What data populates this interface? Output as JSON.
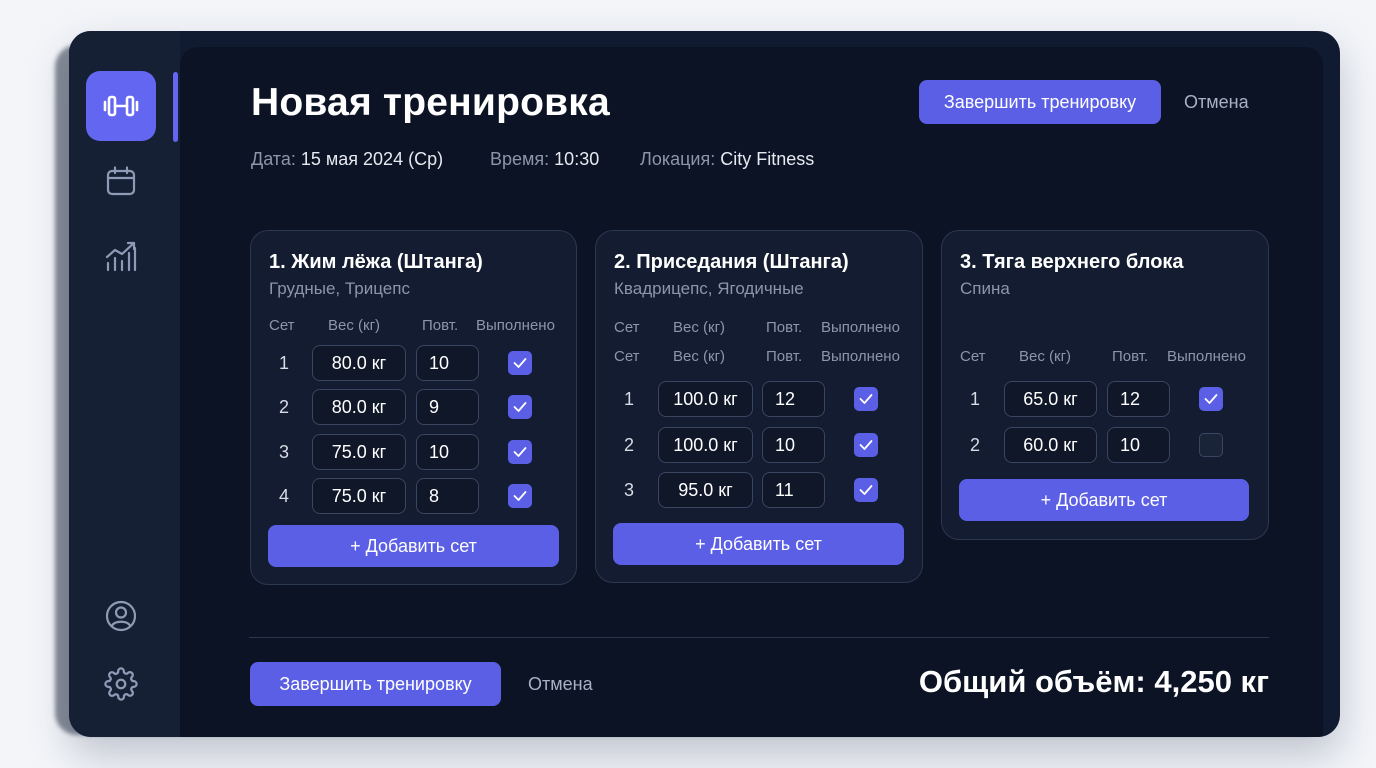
{
  "sidebar": {
    "items": [
      {
        "icon": "dumbbell-icon",
        "active": true
      },
      {
        "icon": "calendar-icon",
        "active": false
      },
      {
        "icon": "chart-icon",
        "active": false
      },
      {
        "icon": "user-icon",
        "active": false
      },
      {
        "icon": "gear-icon",
        "active": false
      }
    ]
  },
  "header": {
    "title": "Новая тренировка",
    "finish_label": "Завершить тренировку",
    "cancel_label": "Отмена"
  },
  "meta": {
    "date_label": "Дата:",
    "date_value": "15 мая 2024 (Ср)",
    "time_label": "Время:",
    "time_value": "10:30",
    "location_label": "Локация:",
    "location_value": "City Fitness"
  },
  "table_headers": {
    "set": "Сет",
    "weight": "Вес (кг)",
    "reps": "Повт.",
    "done": "Выполнено"
  },
  "exercises": [
    {
      "title": "1. Жим лёжа (Штанга)",
      "muscles": "Грудные, Трицепс",
      "sets": [
        {
          "num": "1",
          "weight": "80.0 кг",
          "reps": "10",
          "done": true
        },
        {
          "num": "2",
          "weight": "80.0 кг",
          "reps": "9",
          "done": true
        },
        {
          "num": "3",
          "weight": "75.0 кг",
          "reps": "10",
          "done": true
        },
        {
          "num": "4",
          "weight": "75.0 кг",
          "reps": "8",
          "done": true
        }
      ],
      "add_label": "+ Добавить сет"
    },
    {
      "title": "2. Приседания (Штанга)",
      "muscles": "Квадрицепс, Ягодичные",
      "sets": [
        {
          "num": "1",
          "weight": "100.0 кг",
          "reps": "12",
          "done": true
        },
        {
          "num": "2",
          "weight": "100.0 кг",
          "reps": "10",
          "done": true
        },
        {
          "num": "3",
          "weight": "95.0 кг",
          "reps": "11",
          "done": true
        }
      ],
      "add_label": "+ Добавить сет"
    },
    {
      "title": "3. Тяга верхнего блока",
      "muscles": "Спина",
      "sets": [
        {
          "num": "1",
          "weight": "65.0 кг",
          "reps": "12",
          "done": true
        },
        {
          "num": "2",
          "weight": "60.0 кг",
          "reps": "10",
          "done": false
        }
      ],
      "add_label": "+ Добавить сет"
    }
  ],
  "footer": {
    "finish_label": "Завершить тренировку",
    "cancel_label": "Отмена",
    "total_volume": "Общий объём: 4,250 кг"
  },
  "colors": {
    "accent": "#5b5fe6",
    "background": "#0c1324",
    "sidebar": "#152035"
  }
}
